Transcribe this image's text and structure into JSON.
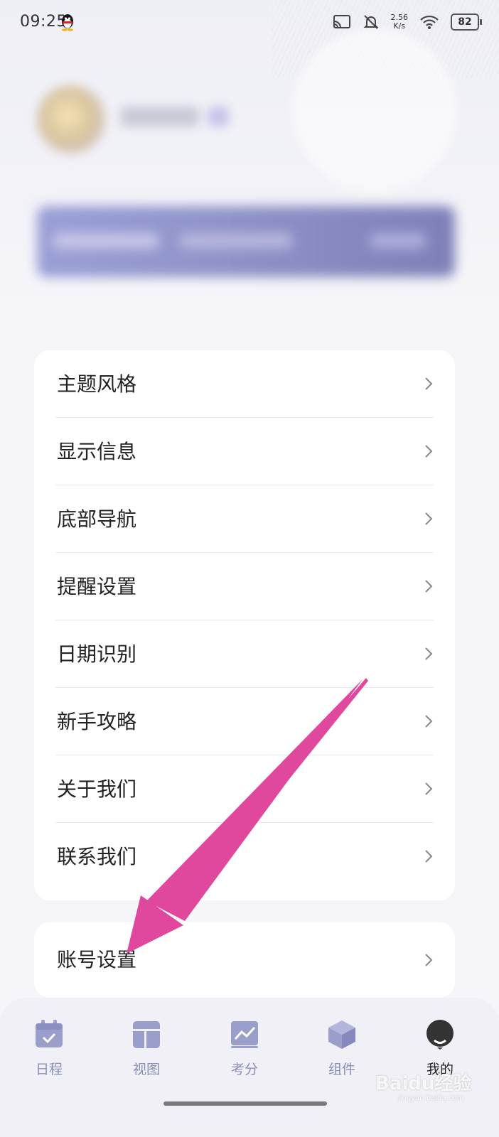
{
  "status_bar": {
    "time": "09:25",
    "net_speed_value": "2.56",
    "net_speed_unit": "K/s",
    "battery": "82"
  },
  "menu": {
    "items": [
      {
        "label": "主题风格"
      },
      {
        "label": "显示信息"
      },
      {
        "label": "底部导航"
      },
      {
        "label": "提醒设置"
      },
      {
        "label": "日期识别"
      },
      {
        "label": "新手攻略"
      },
      {
        "label": "关于我们"
      },
      {
        "label": "联系我们"
      }
    ],
    "account": {
      "label": "账号设置"
    }
  },
  "bottom_nav": {
    "items": [
      {
        "label": "日程",
        "icon": "calendar-icon"
      },
      {
        "label": "视图",
        "icon": "layout-icon"
      },
      {
        "label": "考分",
        "icon": "chart-icon"
      },
      {
        "label": "组件",
        "icon": "cube-icon"
      },
      {
        "label": "我的",
        "icon": "profile-icon",
        "active": true
      }
    ]
  },
  "watermark": {
    "text": "Baidu经验",
    "sub": "jingyan.baidu.com"
  },
  "colors": {
    "accent": "#8b8fb8",
    "annotation_arrow": "#e0489e",
    "card_bg": "#ffffff"
  }
}
